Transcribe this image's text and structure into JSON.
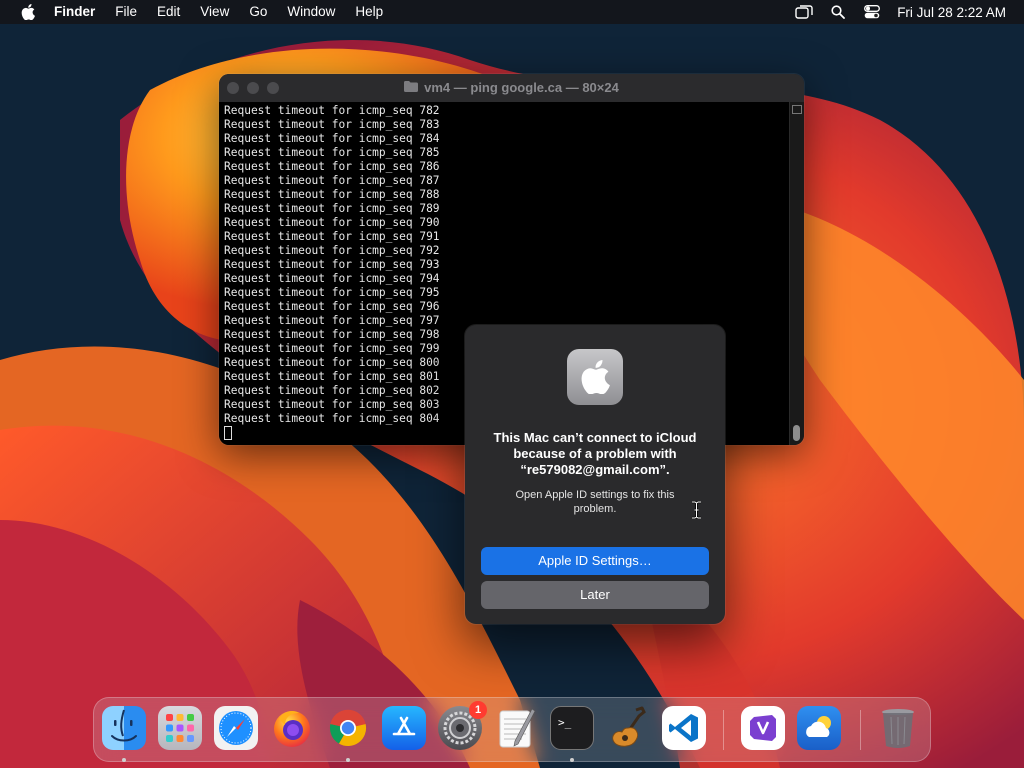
{
  "menubar": {
    "app_name": "Finder",
    "menus": [
      "File",
      "Edit",
      "View",
      "Go",
      "Window",
      "Help"
    ],
    "clock": "Fri Jul 28  2:22 AM",
    "status_icons": [
      "screen-mirroring-icon",
      "search-icon",
      "control-center-icon"
    ]
  },
  "terminal": {
    "title": "vm4 — ping google.ca — 80×24",
    "lines": [
      "Request timeout for icmp_seq 782",
      "Request timeout for icmp_seq 783",
      "Request timeout for icmp_seq 784",
      "Request timeout for icmp_seq 785",
      "Request timeout for icmp_seq 786",
      "Request timeout for icmp_seq 787",
      "Request timeout for icmp_seq 788",
      "Request timeout for icmp_seq 789",
      "Request timeout for icmp_seq 790",
      "Request timeout for icmp_seq 791",
      "Request timeout for icmp_seq 792",
      "Request timeout for icmp_seq 793",
      "Request timeout for icmp_seq 794",
      "Request timeout for icmp_seq 795",
      "Request timeout for icmp_seq 796",
      "Request timeout for icmp_seq 797",
      "Request timeout for icmp_seq 798",
      "Request timeout for icmp_seq 799",
      "Request timeout for icmp_seq 800",
      "Request timeout for icmp_seq 801",
      "Request timeout for icmp_seq 802",
      "Request timeout for icmp_seq 803",
      "Request timeout for icmp_seq 804"
    ]
  },
  "dialog": {
    "headline": "This Mac can’t connect to iCloud because of a problem with “re579082@gmail.com”.",
    "message": "Open Apple ID settings to fix this problem.",
    "primary_button": "Apple ID Settings…",
    "secondary_button": "Later"
  },
  "dock": {
    "items": [
      {
        "name": "finder-icon",
        "running": true
      },
      {
        "name": "launchpad-icon",
        "running": false
      },
      {
        "name": "safari-icon",
        "running": false
      },
      {
        "name": "firefox-icon",
        "running": false
      },
      {
        "name": "chrome-icon",
        "running": true
      },
      {
        "name": "app-store-icon",
        "running": false
      },
      {
        "name": "system-settings-icon",
        "running": false,
        "badge": "1"
      },
      {
        "name": "textedit-icon",
        "running": false
      },
      {
        "name": "terminal-icon",
        "running": true
      },
      {
        "name": "garageband-icon",
        "running": false
      },
      {
        "name": "vscode-icon",
        "running": false
      },
      {
        "name": "visual-studio-icon",
        "running": false
      },
      {
        "name": "weather-icon",
        "running": false
      },
      {
        "name": "trash-icon",
        "running": false
      }
    ]
  }
}
